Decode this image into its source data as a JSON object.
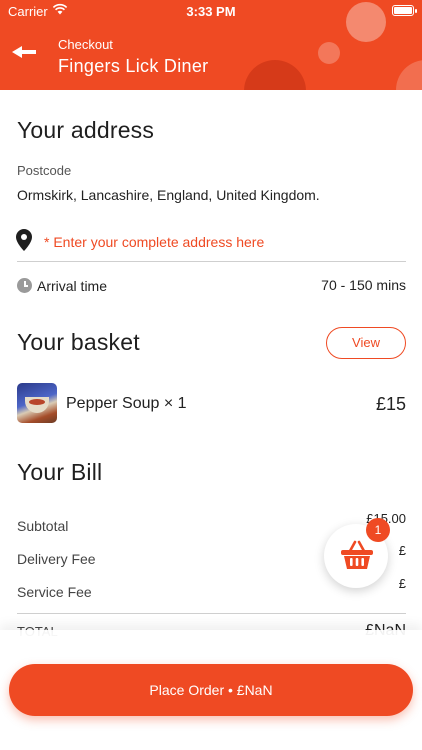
{
  "status_bar": {
    "carrier": "Carrier",
    "time": "3:33 PM"
  },
  "header": {
    "subtitle": "Checkout",
    "title": "Fingers Lick Diner"
  },
  "address": {
    "heading": "Your address",
    "postcode_label": "Postcode",
    "postcode_value": "Ormskirk, Lancashire, England, United Kingdom.",
    "input_placeholder": "* Enter your complete address here",
    "arrival_label": "Arrival time",
    "arrival_value": "70 - 150 mins"
  },
  "basket": {
    "heading": "Your basket",
    "view_label": "View",
    "items": [
      {
        "name": "Pepper Soup × 1",
        "price": "£15"
      }
    ]
  },
  "bill": {
    "heading": "Your Bill",
    "rows": [
      {
        "label": "Subtotal",
        "value": "£15.00"
      },
      {
        "label": "Delivery Fee",
        "value": "£"
      },
      {
        "label": "Service Fee",
        "value": "£"
      },
      {
        "label": "TOTAL",
        "value": "£NaN"
      }
    ]
  },
  "cart_fab": {
    "badge_count": "1",
    "icon": "basket-icon"
  },
  "place_order": {
    "label": "Place Order • £NaN"
  },
  "colors": {
    "accent": "#ef4a23"
  }
}
